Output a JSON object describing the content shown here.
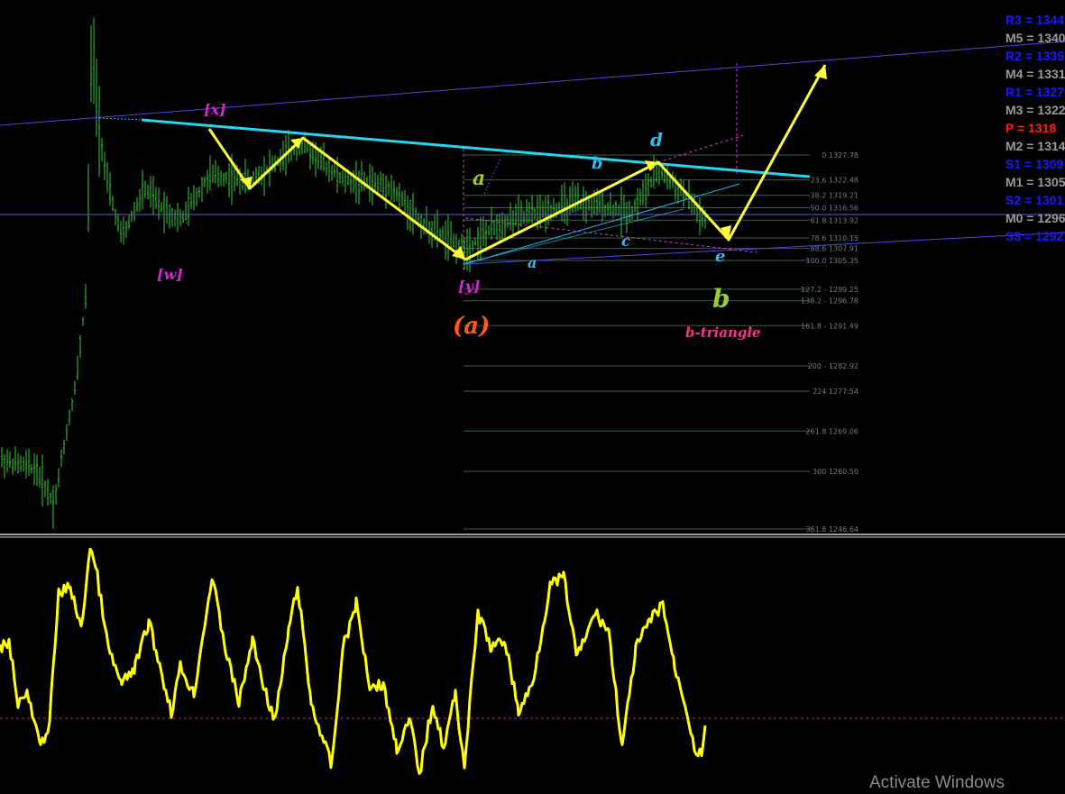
{
  "chart_data": {
    "type": "candlestick",
    "price_axis": {
      "range": [
        1246.64,
        1348
      ]
    },
    "fibonacci": [
      {
        "ratio": "0",
        "price": "1327.78"
      },
      {
        "ratio": "23.6",
        "price": "1322.48"
      },
      {
        "ratio": "38.2",
        "price": "1319.21"
      },
      {
        "ratio": "50.0",
        "price": "1316.56"
      },
      {
        "ratio": "61.8",
        "price": "1313.92"
      },
      {
        "ratio": "78.6",
        "price": "1310.15"
      },
      {
        "ratio": "88.6",
        "price": "1307.91"
      },
      {
        "ratio": "100.0",
        "price": "1305.35"
      },
      {
        "ratio": "127.2 -",
        "price": "1299.25"
      },
      {
        "ratio": "138.2 -",
        "price": "1296.78"
      },
      {
        "ratio": "161.8 -",
        "price": "1291.49"
      },
      {
        "ratio": "200 -",
        "price": "1282.92"
      },
      {
        "ratio": "224",
        "price": "1277.54"
      },
      {
        "ratio": "261.8",
        "price": "1269.06"
      },
      {
        "ratio": "300",
        "price": "1260.50"
      },
      {
        "ratio": "361.8",
        "price": "1246.64"
      }
    ],
    "pivots": [
      {
        "name": "R3",
        "value": "1344",
        "color": "#1a1aff"
      },
      {
        "name": "M5",
        "value": "1340",
        "color": "#9a9a9a"
      },
      {
        "name": "R2",
        "value": "1335",
        "color": "#1a1aff"
      },
      {
        "name": "M4",
        "value": "1331",
        "color": "#9a9a9a"
      },
      {
        "name": "R1",
        "value": "1327",
        "color": "#1a1aff"
      },
      {
        "name": "M3",
        "value": "1322",
        "color": "#9a9a9a"
      },
      {
        "name": "P",
        "value": "1318",
        "color": "#ff1a1a"
      },
      {
        "name": "M2",
        "value": "1314",
        "color": "#9a9a9a"
      },
      {
        "name": "S1",
        "value": "1309",
        "color": "#1a1aff"
      },
      {
        "name": "M1",
        "value": "1305",
        "color": "#9a9a9a"
      },
      {
        "name": "S2",
        "value": "1301",
        "color": "#1a1aff"
      },
      {
        "name": "M0",
        "value": "1296",
        "color": "#9a9a9a"
      },
      {
        "name": "S3",
        "value": "1292",
        "color": "#1a1aff"
      }
    ],
    "wave_labels": {
      "w": "[w]",
      "x": "[x]",
      "y": "[y]",
      "a_main": "(a)",
      "a_green": "a",
      "b_green": "b",
      "a_blue": "a",
      "b_blue": "b",
      "c_blue": "c",
      "d_blue": "d",
      "e_blue": "e",
      "pattern": "b-triangle"
    },
    "oscillator": {
      "line_color": "#ffff00",
      "level_color": "#b0308a"
    }
  },
  "watermark": "Activate Windows"
}
